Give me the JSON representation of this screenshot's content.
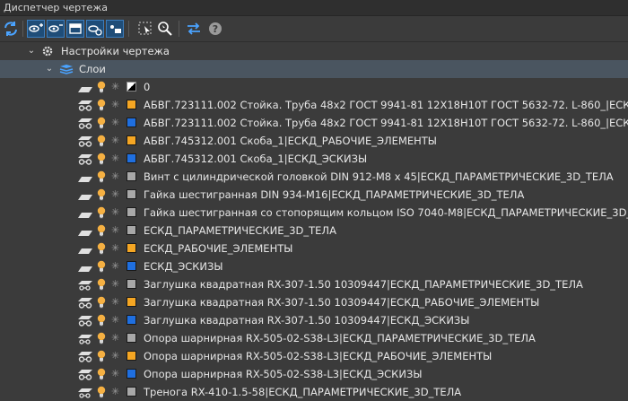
{
  "window": {
    "title": "Диспетчер чертежа"
  },
  "colors": {
    "white_black": "#ffffff",
    "orange": "#f5a623",
    "blue": "#1f6fe0",
    "gray": "#a8a8a8"
  },
  "toolbar": {
    "buttons": [
      {
        "icon": "refresh-icon"
      },
      {
        "icon": "show-layers-icon"
      },
      {
        "icon": "hide-layers-icon"
      },
      {
        "icon": "lock-layers-icon"
      },
      {
        "icon": "freeze-layers-icon"
      },
      {
        "icon": "isolate-layers-icon"
      },
      {
        "icon": "select-objects-icon"
      },
      {
        "icon": "zoom-to-objects-icon"
      },
      {
        "icon": "swap-icon"
      },
      {
        "icon": "help-icon"
      }
    ]
  },
  "tree": {
    "settings_label": "Настройки чертежа",
    "layers_label": "Слои",
    "layers": [
      {
        "name": "0",
        "color": "white_black",
        "vis": "flat"
      },
      {
        "name": "АБВГ.723111.002 Стойка. Труба 48х2 ГОСТ 9941-81 12Х18Н10Т ГОСТ 5632-72. L-860_|ЕСКД_РАБОЧИЕ",
        "color": "orange",
        "vis": "glasses"
      },
      {
        "name": "АБВГ.723111.002 Стойка. Труба 48х2 ГОСТ 9941-81 12Х18Н10Т ГОСТ 5632-72. L-860_|ЕСКД_ЭСКИЗЫ",
        "color": "blue",
        "vis": "glasses"
      },
      {
        "name": "АБВГ.745312.001 Скоба_1|ЕСКД_РАБОЧИЕ_ЭЛЕМЕНТЫ",
        "color": "orange",
        "vis": "glasses"
      },
      {
        "name": "АБВГ.745312.001 Скоба_1|ЕСКД_ЭСКИЗЫ",
        "color": "blue",
        "vis": "glasses"
      },
      {
        "name": "Винт с цилиндрической головкой DIN 912-M8 x 45|ЕСКД_ПАРАМЕТРИЧЕСКИЕ_3D_ТЕЛА",
        "color": "gray",
        "vis": "flat"
      },
      {
        "name": "Гайка шестигранная DIN 934-M16|ЕСКД_ПАРАМЕТРИЧЕСКИЕ_3D_ТЕЛА",
        "color": "gray",
        "vis": "flat"
      },
      {
        "name": "Гайка шестигранная со стопорящим кольцом ISO 7040-M8|ЕСКД_ПАРАМЕТРИЧЕСКИЕ_3D_ТЕЛА",
        "color": "gray",
        "vis": "flat"
      },
      {
        "name": "ЕСКД_ПАРАМЕТРИЧЕСКИЕ_3D_ТЕЛА",
        "color": "gray",
        "vis": "flat"
      },
      {
        "name": "ЕСКД_РАБОЧИЕ_ЭЛЕМЕНТЫ",
        "color": "orange",
        "vis": "flat"
      },
      {
        "name": "ЕСКД_ЭСКИЗЫ",
        "color": "blue",
        "vis": "flat"
      },
      {
        "name": "Заглушка квадратная RX-307-1.50 10309447|ЕСКД_ПАРАМЕТРИЧЕСКИЕ_3D_ТЕЛА",
        "color": "gray",
        "vis": "stack"
      },
      {
        "name": "Заглушка квадратная RX-307-1.50 10309447|ЕСКД_РАБОЧИЕ_ЭЛЕМЕНТЫ",
        "color": "orange",
        "vis": "glasses"
      },
      {
        "name": "Заглушка квадратная RX-307-1.50 10309447|ЕСКД_ЭСКИЗЫ",
        "color": "blue",
        "vis": "glasses"
      },
      {
        "name": "Опора шарнирная RX-505-02-S38-L3|ЕСКД_ПАРАМЕТРИЧЕСКИЕ_3D_ТЕЛА",
        "color": "gray",
        "vis": "stack"
      },
      {
        "name": "Опора шарнирная RX-505-02-S38-L3|ЕСКД_РАБОЧИЕ_ЭЛЕМЕНТЫ",
        "color": "orange",
        "vis": "glasses"
      },
      {
        "name": "Опора шарнирная RX-505-02-S38-L3|ЕСКД_ЭСКИЗЫ",
        "color": "blue",
        "vis": "glasses"
      },
      {
        "name": "Тренога RX-410-1.5-58|ЕСКД_ПАРАМЕТРИЧЕСКИЕ_3D_ТЕЛА",
        "color": "gray",
        "vis": "stack"
      }
    ]
  }
}
